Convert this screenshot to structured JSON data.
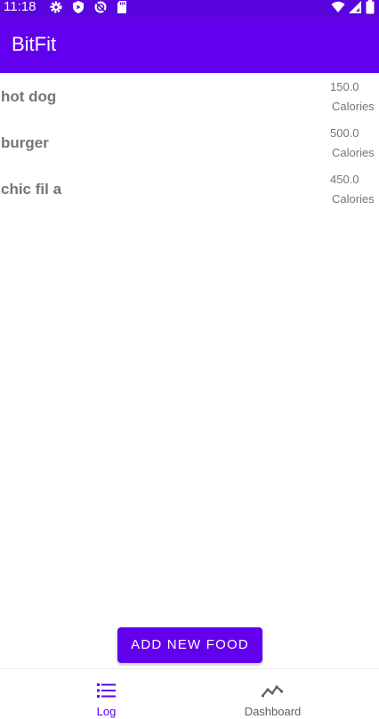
{
  "status_bar": {
    "time": "11:18",
    "icons": [
      "settings-icon",
      "play-protect-icon",
      "sync-icon",
      "sd-card-icon",
      "wifi-icon",
      "signal-icon",
      "battery-icon"
    ]
  },
  "app_bar": {
    "title": "BitFit"
  },
  "food_list": [
    {
      "name": "hot dog",
      "calories": "150.0",
      "unit": "Calories"
    },
    {
      "name": "burger",
      "calories": "500.0",
      "unit": "Calories"
    },
    {
      "name": "chic fil a",
      "calories": "450.0",
      "unit": "Calories"
    }
  ],
  "add_button": {
    "label": "ADD NEW FOOD"
  },
  "bottom_nav": {
    "items": [
      {
        "label": "Log",
        "icon": "list-icon",
        "selected": true
      },
      {
        "label": "Dashboard",
        "icon": "trending-chart-icon",
        "selected": false
      }
    ]
  },
  "colors": {
    "primary": "#6200ee",
    "status_bar": "#5a05de",
    "text_secondary": "#757575",
    "nav_inactive": "#5f5f5f"
  }
}
